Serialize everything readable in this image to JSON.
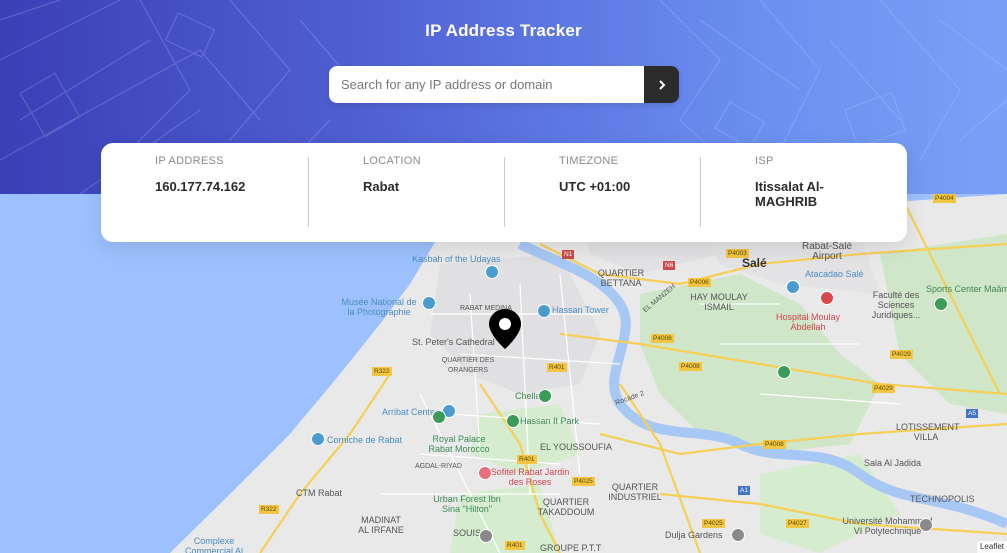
{
  "header": {
    "title": "IP Address Tracker",
    "background_color_left": "#3a3fb6",
    "background_color_right": "#7aa0f6"
  },
  "search": {
    "placeholder": "Search for any IP address or domain",
    "value": "",
    "button_icon": "chevron-right-icon"
  },
  "info": {
    "ip_label": "IP ADDRESS",
    "ip_value": "160.177.74.162",
    "location_label": "LOCATION",
    "location_value": "Rabat",
    "timezone_label": "TIMEZONE",
    "timezone_value": "UTC +01:00",
    "isp_label": "ISP",
    "isp_value": "Itissalat Al-MAGHRIB"
  },
  "map": {
    "marker_icon": "location-pin-icon",
    "attribution": "Leaflet",
    "labels": {
      "kasbah": "Kasbah of the Udayas",
      "musee": "Musée National de la Photographie",
      "cathedral": "St. Peter's Cathedral",
      "hassan_tower": "Hassan Tower",
      "chellah": "Chellah",
      "hassan_park": "Hassan II Park",
      "arribat": "Arribat Center",
      "corniche": "Corniche de Rabat",
      "royal_palace": "Royal Palace Rabat Morocco",
      "sofitel": "Sofitel Rabat Jardin des Roses",
      "urban_forest": "Urban Forest Ibn Sina \"Hilton\"",
      "ctm": "CTM Rabat",
      "complexe": "Complexe Commercial Al Manal",
      "quartier_bettana": "QUARTIER BETTANA",
      "quartier_orangers": "QUARTIER DES ORANGERS",
      "el_youssoufia": "EL YOUSSOUFIA",
      "agdal": "AGDAL-RIYAD",
      "madinat": "MADINAT AL IRFANE",
      "souissi": "SOUISSI",
      "takaddoum": "QUARTIER TAKADDOUM",
      "industriel": "QUARTIER INDUSTRIEL",
      "groupe": "GROUPE P.T.T",
      "hay_moulay": "HAY MOULAY ISMAIL",
      "sale": "Salé",
      "rabat_sale_airport": "Rabat-Salé Airport",
      "atacadao": "Atacadao Salé",
      "hospital": "Hospital Moulay Abdellah",
      "faculte": "Faculté des Sciences Juridiques...",
      "sports_center": "Sports Center Maâm",
      "lotissement": "LOTISSEMENT VILLA",
      "sala_jadida": "Sala Al Jadida",
      "technopolis": "TECHNOPOLIS",
      "universite": "Université Mohammed VI Polytechnique",
      "dulja": "Dulja Gardens",
      "rabat_medina": "RABAT MEDINA",
      "rocade": "Rocade 2",
      "el_manzeh": "EL MANZEH"
    },
    "roads": {
      "n1": "N1",
      "n6": "N6",
      "p4006": "P4006",
      "p4008": "P4008",
      "p4008b": "P4008",
      "p4008c": "P4008",
      "p4029": "P4029",
      "p4029b": "P4029",
      "p4004": "P4004",
      "r401": "R401",
      "r401b": "R401",
      "r401c": "R401",
      "r322": "R322",
      "r322b": "R322",
      "p4025": "P4025",
      "p4025b": "P4025",
      "p4027": "P4027",
      "a1": "A1",
      "a5": "A5",
      "p4003": "P4003"
    }
  }
}
